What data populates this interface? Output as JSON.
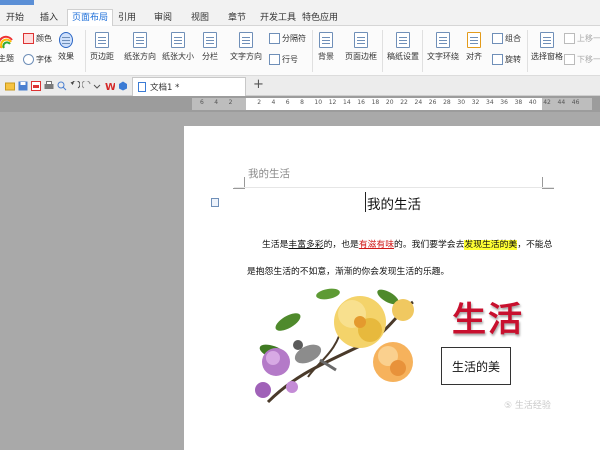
{
  "menu": {
    "tabs": [
      "开始",
      "插入",
      "页面布局",
      "引用",
      "审阅",
      "视图",
      "章节",
      "开发工具",
      "特色应用"
    ],
    "active_tab": "页面布局"
  },
  "ribbon": {
    "theme": "主题",
    "color": "颜色",
    "font": "字体",
    "effect": "效果",
    "margin": "页边距",
    "orientation": "纸张方向",
    "size": "纸张大小",
    "columns": "分栏",
    "text_direction": "文字方向",
    "separator": "分隔符",
    "line_number": "行号",
    "background": "背景",
    "page_border": "页面边框",
    "manuscript": "稿纸设置",
    "wrap": "文字环绕",
    "align": "对齐",
    "group": "组合",
    "rotate": "旋转",
    "selection_pane": "选择窗格",
    "bring_forward": "上移一",
    "send_backward": "下移一"
  },
  "tabbar": {
    "doc_tab": "文档1 *",
    "new_tab": "+"
  },
  "ruler": {
    "ticks": [
      "6",
      "4",
      "2",
      "",
      "2",
      "4",
      "6",
      "8",
      "10",
      "12",
      "14",
      "16",
      "18",
      "20",
      "22",
      "24",
      "26",
      "28",
      "30",
      "32",
      "34",
      "36",
      "38",
      "40",
      "42",
      "44",
      "46"
    ]
  },
  "document": {
    "header_text": "我的生活",
    "title": "我的生活",
    "line1": {
      "a": "生活是",
      "b": "丰富多彩",
      "c": "的，也是",
      "d": "有滋有味",
      "e": "的。我们要学会去",
      "f": "发现生活的美",
      "g": "，不能总"
    },
    "line2": "是抱怨生活的不如意，渐渐的你会发现生活的乐趣。",
    "wordart": "生活",
    "textbox": "生活的美"
  },
  "watermark": "⑤ 生活经验",
  "colors": {
    "accent": "#1e6fd9",
    "highlight": "#ffff33",
    "wordart": "#c8102e",
    "link_red": "#d01818"
  }
}
